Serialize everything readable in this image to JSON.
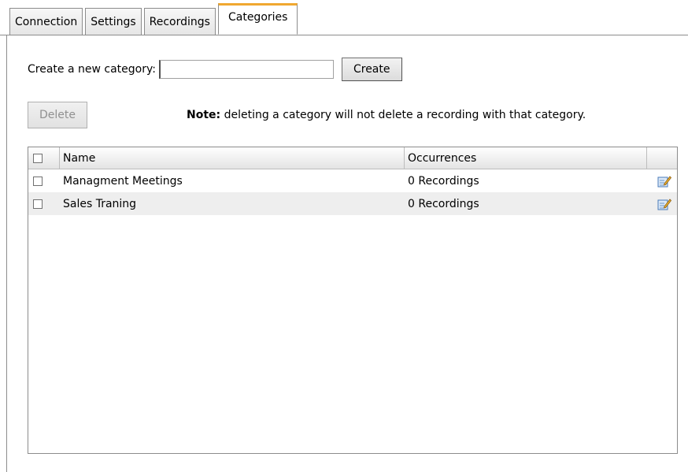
{
  "tabs": [
    {
      "label": "Connection",
      "active": false
    },
    {
      "label": "Settings",
      "active": false
    },
    {
      "label": "Recordings",
      "active": false
    },
    {
      "label": "Categories",
      "active": true
    }
  ],
  "create": {
    "label": "Create a new category:",
    "input_value": "",
    "button_label": "Create"
  },
  "delete": {
    "button_label": "Delete",
    "enabled": false
  },
  "note": {
    "bold": "Note:",
    "text": " deleting a category will not delete a recording with that category."
  },
  "grid": {
    "columns": {
      "name": "Name",
      "occurrences": "Occurrences"
    },
    "rows": [
      {
        "name": "Managment Meetings",
        "occurrences": "0 Recordings",
        "edit_icon": "edit-icon"
      },
      {
        "name": "Sales Traning",
        "occurrences": "0 Recordings",
        "edit_icon": "edit-icon"
      }
    ]
  },
  "colors": {
    "active_tab_accent": "#f0a830",
    "border": "#8c8c8c",
    "alt_row": "#eeeeee"
  }
}
